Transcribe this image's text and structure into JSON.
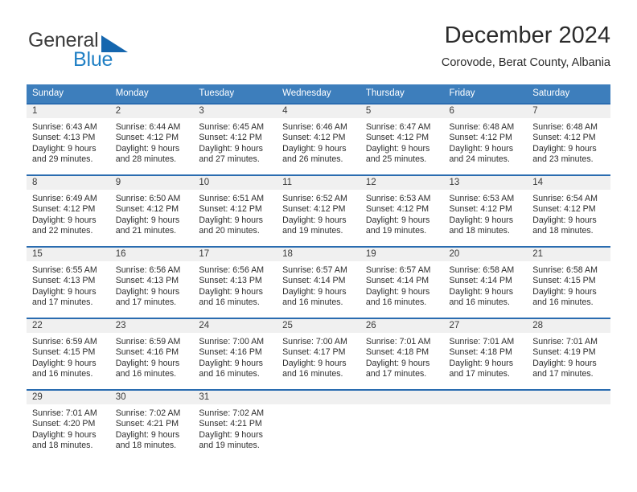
{
  "brand": {
    "name_part1": "General",
    "name_part2": "Blue",
    "logo_colors": {
      "text": "#3c3c3c",
      "blue": "#1f7fc4",
      "triangle": "#1566ae"
    }
  },
  "header": {
    "title": "December 2024",
    "subtitle": "Corovode, Berat County, Albania"
  },
  "theme": {
    "header_bar": "#3d7ebc",
    "cell_top_border": "#2a6cb0",
    "daynum_strip": "#f0f0f0"
  },
  "weekdays": [
    "Sunday",
    "Monday",
    "Tuesday",
    "Wednesday",
    "Thursday",
    "Friday",
    "Saturday"
  ],
  "weeks": [
    [
      {
        "day": "1",
        "sunrise": "Sunrise: 6:43 AM",
        "sunset": "Sunset: 4:13 PM",
        "daylight1": "Daylight: 9 hours",
        "daylight2": "and 29 minutes."
      },
      {
        "day": "2",
        "sunrise": "Sunrise: 6:44 AM",
        "sunset": "Sunset: 4:12 PM",
        "daylight1": "Daylight: 9 hours",
        "daylight2": "and 28 minutes."
      },
      {
        "day": "3",
        "sunrise": "Sunrise: 6:45 AM",
        "sunset": "Sunset: 4:12 PM",
        "daylight1": "Daylight: 9 hours",
        "daylight2": "and 27 minutes."
      },
      {
        "day": "4",
        "sunrise": "Sunrise: 6:46 AM",
        "sunset": "Sunset: 4:12 PM",
        "daylight1": "Daylight: 9 hours",
        "daylight2": "and 26 minutes."
      },
      {
        "day": "5",
        "sunrise": "Sunrise: 6:47 AM",
        "sunset": "Sunset: 4:12 PM",
        "daylight1": "Daylight: 9 hours",
        "daylight2": "and 25 minutes."
      },
      {
        "day": "6",
        "sunrise": "Sunrise: 6:48 AM",
        "sunset": "Sunset: 4:12 PM",
        "daylight1": "Daylight: 9 hours",
        "daylight2": "and 24 minutes."
      },
      {
        "day": "7",
        "sunrise": "Sunrise: 6:48 AM",
        "sunset": "Sunset: 4:12 PM",
        "daylight1": "Daylight: 9 hours",
        "daylight2": "and 23 minutes."
      }
    ],
    [
      {
        "day": "8",
        "sunrise": "Sunrise: 6:49 AM",
        "sunset": "Sunset: 4:12 PM",
        "daylight1": "Daylight: 9 hours",
        "daylight2": "and 22 minutes."
      },
      {
        "day": "9",
        "sunrise": "Sunrise: 6:50 AM",
        "sunset": "Sunset: 4:12 PM",
        "daylight1": "Daylight: 9 hours",
        "daylight2": "and 21 minutes."
      },
      {
        "day": "10",
        "sunrise": "Sunrise: 6:51 AM",
        "sunset": "Sunset: 4:12 PM",
        "daylight1": "Daylight: 9 hours",
        "daylight2": "and 20 minutes."
      },
      {
        "day": "11",
        "sunrise": "Sunrise: 6:52 AM",
        "sunset": "Sunset: 4:12 PM",
        "daylight1": "Daylight: 9 hours",
        "daylight2": "and 19 minutes."
      },
      {
        "day": "12",
        "sunrise": "Sunrise: 6:53 AM",
        "sunset": "Sunset: 4:12 PM",
        "daylight1": "Daylight: 9 hours",
        "daylight2": "and 19 minutes."
      },
      {
        "day": "13",
        "sunrise": "Sunrise: 6:53 AM",
        "sunset": "Sunset: 4:12 PM",
        "daylight1": "Daylight: 9 hours",
        "daylight2": "and 18 minutes."
      },
      {
        "day": "14",
        "sunrise": "Sunrise: 6:54 AM",
        "sunset": "Sunset: 4:12 PM",
        "daylight1": "Daylight: 9 hours",
        "daylight2": "and 18 minutes."
      }
    ],
    [
      {
        "day": "15",
        "sunrise": "Sunrise: 6:55 AM",
        "sunset": "Sunset: 4:13 PM",
        "daylight1": "Daylight: 9 hours",
        "daylight2": "and 17 minutes."
      },
      {
        "day": "16",
        "sunrise": "Sunrise: 6:56 AM",
        "sunset": "Sunset: 4:13 PM",
        "daylight1": "Daylight: 9 hours",
        "daylight2": "and 17 minutes."
      },
      {
        "day": "17",
        "sunrise": "Sunrise: 6:56 AM",
        "sunset": "Sunset: 4:13 PM",
        "daylight1": "Daylight: 9 hours",
        "daylight2": "and 16 minutes."
      },
      {
        "day": "18",
        "sunrise": "Sunrise: 6:57 AM",
        "sunset": "Sunset: 4:14 PM",
        "daylight1": "Daylight: 9 hours",
        "daylight2": "and 16 minutes."
      },
      {
        "day": "19",
        "sunrise": "Sunrise: 6:57 AM",
        "sunset": "Sunset: 4:14 PM",
        "daylight1": "Daylight: 9 hours",
        "daylight2": "and 16 minutes."
      },
      {
        "day": "20",
        "sunrise": "Sunrise: 6:58 AM",
        "sunset": "Sunset: 4:14 PM",
        "daylight1": "Daylight: 9 hours",
        "daylight2": "and 16 minutes."
      },
      {
        "day": "21",
        "sunrise": "Sunrise: 6:58 AM",
        "sunset": "Sunset: 4:15 PM",
        "daylight1": "Daylight: 9 hours",
        "daylight2": "and 16 minutes."
      }
    ],
    [
      {
        "day": "22",
        "sunrise": "Sunrise: 6:59 AM",
        "sunset": "Sunset: 4:15 PM",
        "daylight1": "Daylight: 9 hours",
        "daylight2": "and 16 minutes."
      },
      {
        "day": "23",
        "sunrise": "Sunrise: 6:59 AM",
        "sunset": "Sunset: 4:16 PM",
        "daylight1": "Daylight: 9 hours",
        "daylight2": "and 16 minutes."
      },
      {
        "day": "24",
        "sunrise": "Sunrise: 7:00 AM",
        "sunset": "Sunset: 4:16 PM",
        "daylight1": "Daylight: 9 hours",
        "daylight2": "and 16 minutes."
      },
      {
        "day": "25",
        "sunrise": "Sunrise: 7:00 AM",
        "sunset": "Sunset: 4:17 PM",
        "daylight1": "Daylight: 9 hours",
        "daylight2": "and 16 minutes."
      },
      {
        "day": "26",
        "sunrise": "Sunrise: 7:01 AM",
        "sunset": "Sunset: 4:18 PM",
        "daylight1": "Daylight: 9 hours",
        "daylight2": "and 17 minutes."
      },
      {
        "day": "27",
        "sunrise": "Sunrise: 7:01 AM",
        "sunset": "Sunset: 4:18 PM",
        "daylight1": "Daylight: 9 hours",
        "daylight2": "and 17 minutes."
      },
      {
        "day": "28",
        "sunrise": "Sunrise: 7:01 AM",
        "sunset": "Sunset: 4:19 PM",
        "daylight1": "Daylight: 9 hours",
        "daylight2": "and 17 minutes."
      }
    ],
    [
      {
        "day": "29",
        "sunrise": "Sunrise: 7:01 AM",
        "sunset": "Sunset: 4:20 PM",
        "daylight1": "Daylight: 9 hours",
        "daylight2": "and 18 minutes."
      },
      {
        "day": "30",
        "sunrise": "Sunrise: 7:02 AM",
        "sunset": "Sunset: 4:21 PM",
        "daylight1": "Daylight: 9 hours",
        "daylight2": "and 18 minutes."
      },
      {
        "day": "31",
        "sunrise": "Sunrise: 7:02 AM",
        "sunset": "Sunset: 4:21 PM",
        "daylight1": "Daylight: 9 hours",
        "daylight2": "and 19 minutes."
      },
      {
        "day": "",
        "sunrise": "",
        "sunset": "",
        "daylight1": "",
        "daylight2": ""
      },
      {
        "day": "",
        "sunrise": "",
        "sunset": "",
        "daylight1": "",
        "daylight2": ""
      },
      {
        "day": "",
        "sunrise": "",
        "sunset": "",
        "daylight1": "",
        "daylight2": ""
      },
      {
        "day": "",
        "sunrise": "",
        "sunset": "",
        "daylight1": "",
        "daylight2": ""
      }
    ]
  ]
}
